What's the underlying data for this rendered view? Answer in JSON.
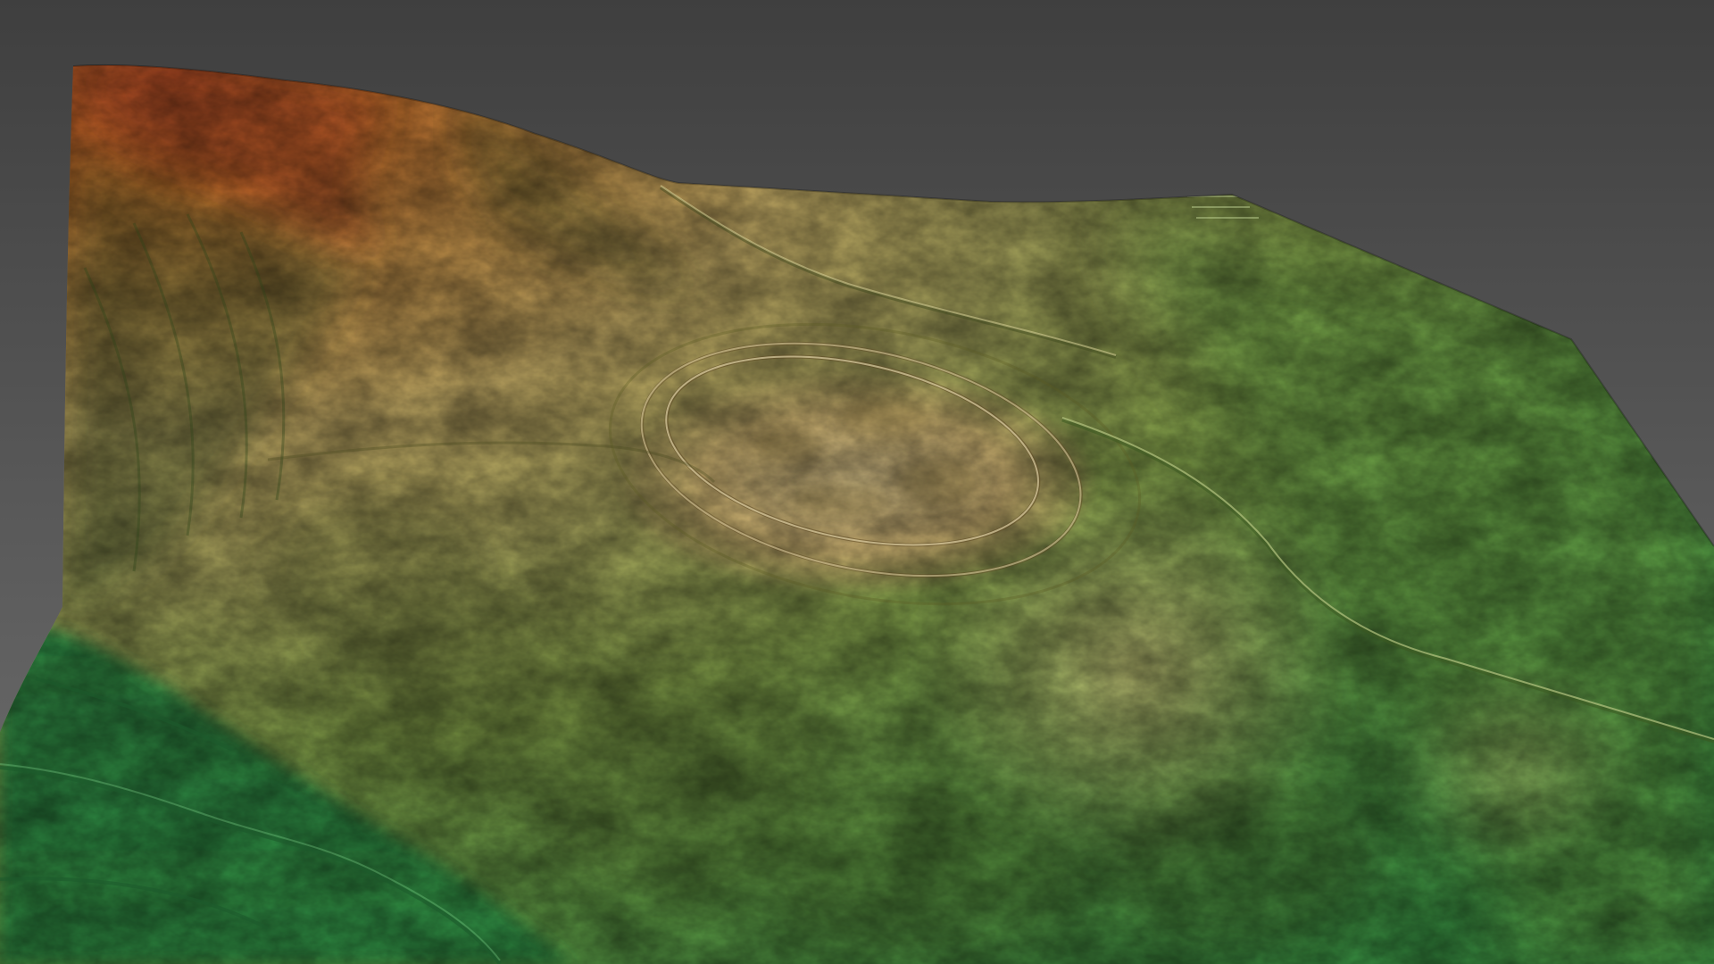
{
  "scene": {
    "subject": "terrain-relief-model",
    "colors": {
      "background_top": "#3f3f3f",
      "background_bottom": "#6e6e6e",
      "terrain_low": "#2f8a43",
      "terrain_mid": "#8fbc52",
      "terrain_high": "#e8d28a",
      "terrain_peak": "#d8692f"
    }
  }
}
